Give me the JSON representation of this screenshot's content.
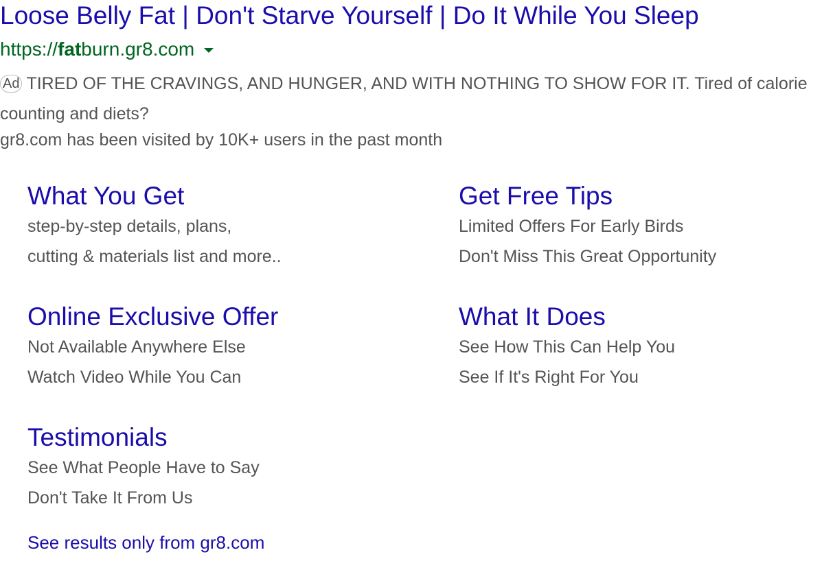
{
  "ad": {
    "title": "Loose Belly Fat | Don't Starve Yourself | Do It While You Sleep",
    "url_prefix": "https://",
    "url_bold": "fat",
    "url_rest": "burn.gr8.com",
    "badge": "Ad",
    "description": "TIRED OF THE CRAVINGS, AND HUNGER, AND WITH NOTHING TO SHOW FOR IT. Tired of calorie counting and diets?",
    "visited": "gr8.com has been visited by 10K+ users in the past month",
    "colors": {
      "link": "#1a0dab",
      "url": "#006621",
      "text": "#545454"
    }
  },
  "sitelinks": [
    {
      "title": "What You Get",
      "lines": [
        "step-by-step details, plans,",
        "cutting & materials list and more.."
      ]
    },
    {
      "title": "Get Free Tips",
      "lines": [
        "Limited Offers For Early Birds",
        "Don't Miss This Great Opportunity"
      ]
    },
    {
      "title": "Online Exclusive Offer",
      "lines": [
        "Not Available Anywhere Else",
        "Watch Video While You Can"
      ]
    },
    {
      "title": "What It Does",
      "lines": [
        "See How This Can Help You",
        "See If It's Right For You"
      ]
    },
    {
      "title": "Testimonials",
      "lines": [
        "See What People Have to Say",
        "Don't Take It From Us"
      ]
    }
  ],
  "more_link": "See results only from gr8.com"
}
